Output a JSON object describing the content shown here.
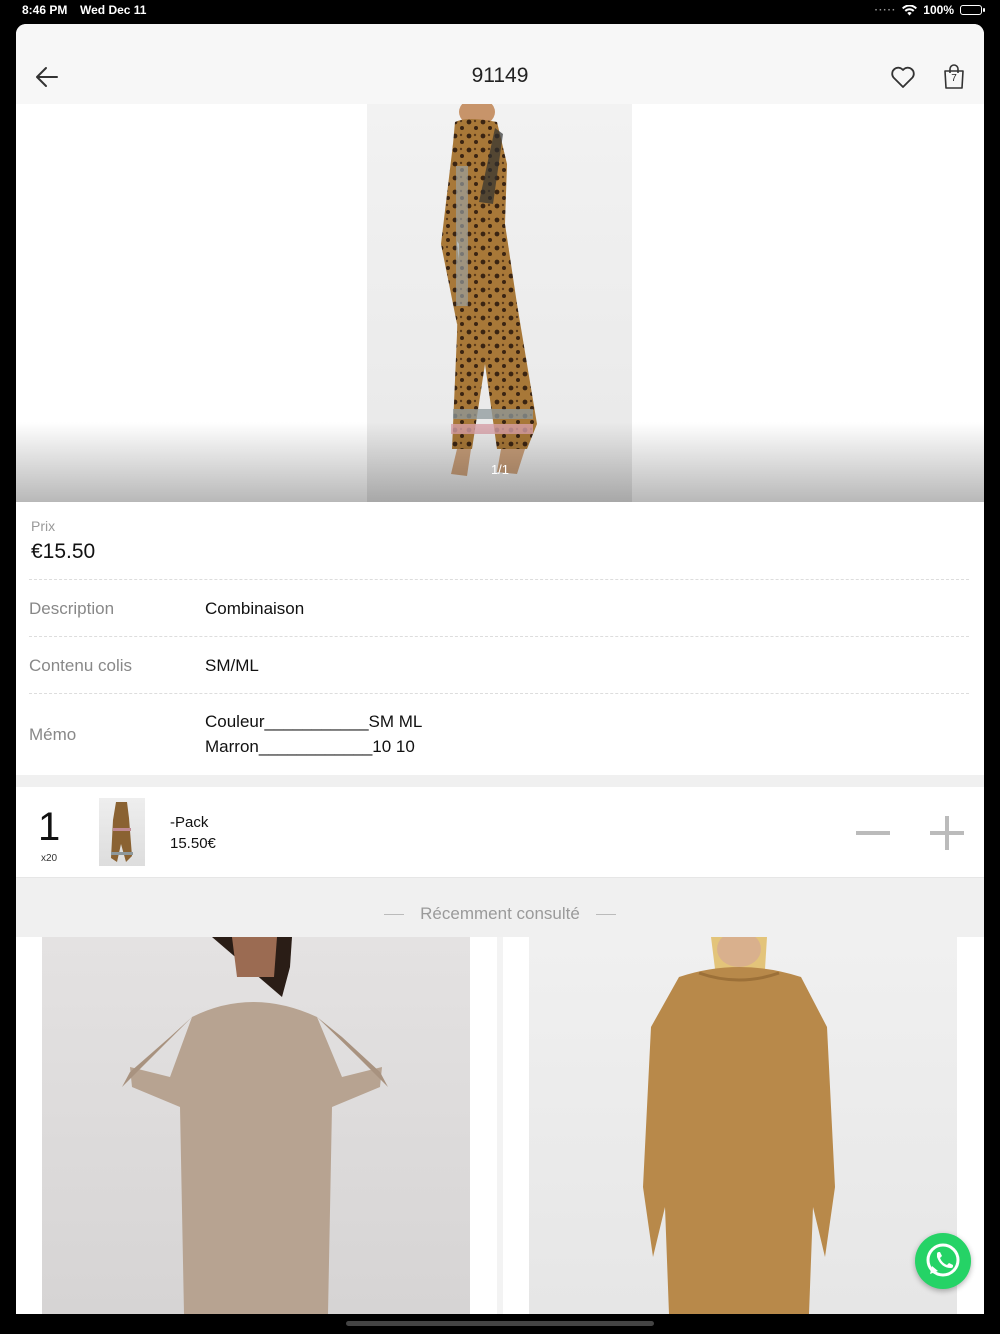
{
  "status_bar": {
    "time": "8:46 PM",
    "date": "Wed Dec 11",
    "battery": "100%"
  },
  "header": {
    "title": "91149",
    "cart_count": "7"
  },
  "gallery": {
    "page_indicator": "1/1"
  },
  "price": {
    "label": "Prix",
    "value": "€15.50"
  },
  "details": {
    "description_label": "Description",
    "description_value": "Combinaison",
    "contents_label": "Contenu colis",
    "contents_value": "SM/ML",
    "memo_label": "Mémo",
    "memo_line_1": "Couleur___________SM   ML",
    "memo_line_2": "Marron____________10   10"
  },
  "pack": {
    "quantity": "1",
    "multiplier": "x20",
    "name": "-Pack",
    "price": "15.50€"
  },
  "recent": {
    "title": "Récemment consulté"
  },
  "colors": {
    "accent": "#25d366",
    "background": "#ffffff",
    "separator": "#f0f0f0"
  }
}
